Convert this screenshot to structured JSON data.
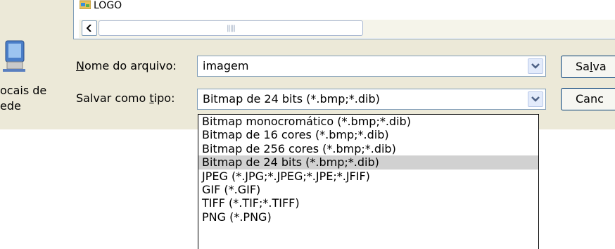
{
  "file_list": {
    "entry": "LOGO"
  },
  "places": {
    "network_label": "ocais de\nede"
  },
  "filename": {
    "label_accel": "N",
    "label_rest": "ome do arquivo:",
    "value": "imagem"
  },
  "filetype": {
    "label_pre": "Salvar como ",
    "label_accel": "t",
    "label_post": "ipo:",
    "value": "Bitmap de 24 bits (*.bmp;*.dib)"
  },
  "buttons": {
    "save_pre": "Sa",
    "save_accel": "l",
    "save_post": "va",
    "cancel": "Canc"
  },
  "dropdown_options": [
    "Bitmap monocromático (*.bmp;*.dib)",
    "Bitmap de 16 cores (*.bmp;*.dib)",
    "Bitmap de 256 cores (*.bmp;*.dib)",
    "Bitmap de 24 bits (*.bmp;*.dib)",
    "JPEG (*.JPG;*.JPEG;*.JPE;*.JFIF)",
    "GIF (*.GIF)",
    "TIFF (*.TIF;*.TIFF)",
    "PNG (*.PNG)"
  ],
  "selected_option_index": 3,
  "colors": {
    "dialog_bg": "#ece9d8",
    "field_border": "#7f9db9",
    "selected_row": "#d1d1d1",
    "button_border": "#003c74"
  }
}
